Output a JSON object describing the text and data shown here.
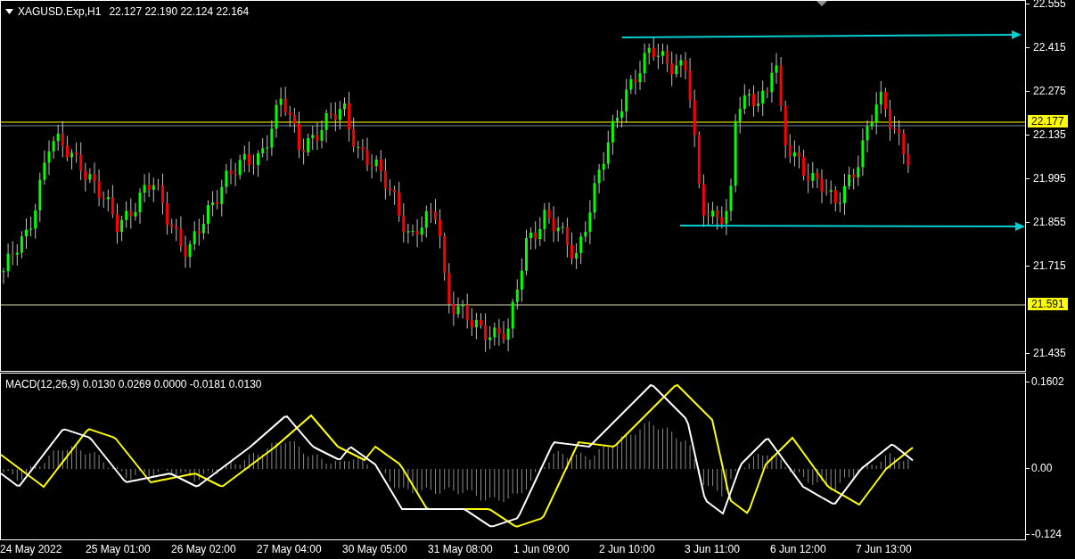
{
  "price_chart": {
    "symbol": "XAGUSD.Exp,H1",
    "quotes": "22.127 22.190 22.124 22.164",
    "price_ticks": [
      "22.555",
      "22.415",
      "22.275",
      "22.135",
      "21.995",
      "21.855",
      "21.715",
      "21.435"
    ],
    "price_labels": [
      "22.177",
      "21.591"
    ]
  },
  "macd": {
    "title": "MACD(12,26,9) 0.0130 0.0269 0.0000 -0.0181 0.0130",
    "ticks": [
      "0.1602",
      "0.00",
      "-0.124"
    ]
  },
  "time_axis": [
    "24 May 2022",
    "25 May 01:00",
    "26 May 02:00",
    "27 May 04:00",
    "30 May 05:00",
    "31 May 08:00",
    "1 Jun 09:00",
    "2 Jun 10:00",
    "3 Jun 11:00",
    "6 Jun 12:00",
    "7 Jun 13:00"
  ]
}
